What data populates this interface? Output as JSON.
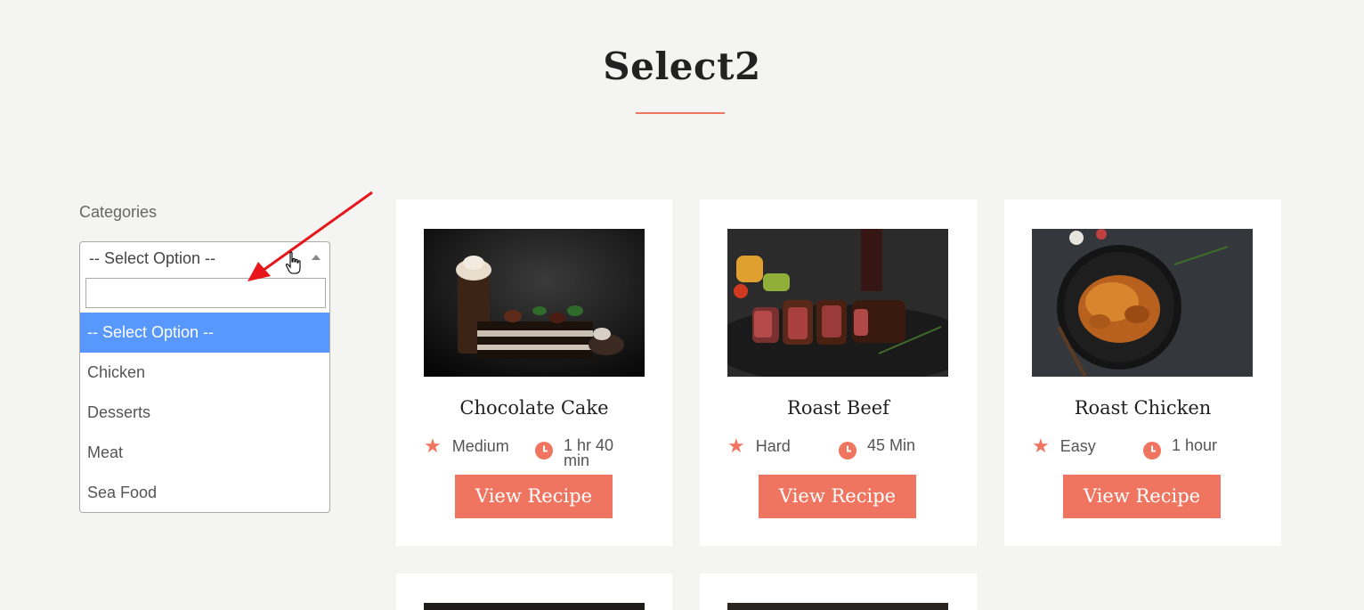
{
  "page": {
    "title": "Select2"
  },
  "sidebar": {
    "categories_label": "Categories",
    "select": {
      "value": "-- Select Option --",
      "search_value": "",
      "options": [
        {
          "label": "-- Select Option --",
          "highlighted": true
        },
        {
          "label": "Chicken",
          "highlighted": false
        },
        {
          "label": "Desserts",
          "highlighted": false
        },
        {
          "label": "Meat",
          "highlighted": false
        },
        {
          "label": "Sea Food",
          "highlighted": false
        }
      ]
    }
  },
  "cards": [
    {
      "title": "Chocolate Cake",
      "difficulty": "Medium",
      "time": "1 hr 40 min",
      "button": "View Recipe"
    },
    {
      "title": "Roast Beef",
      "difficulty": "Hard",
      "time": "45 Min",
      "button": "View Recipe"
    },
    {
      "title": "Roast Chicken",
      "difficulty": "Easy",
      "time": "1 hour",
      "button": "View Recipe"
    }
  ],
  "colors": {
    "accent": "#f07560",
    "highlight": "#5897fb",
    "background": "#f4f4f2",
    "annotation": "#e8161a"
  },
  "icons": [
    "star-icon",
    "clock-icon",
    "hand-cursor-icon",
    "chevron-up-icon"
  ]
}
